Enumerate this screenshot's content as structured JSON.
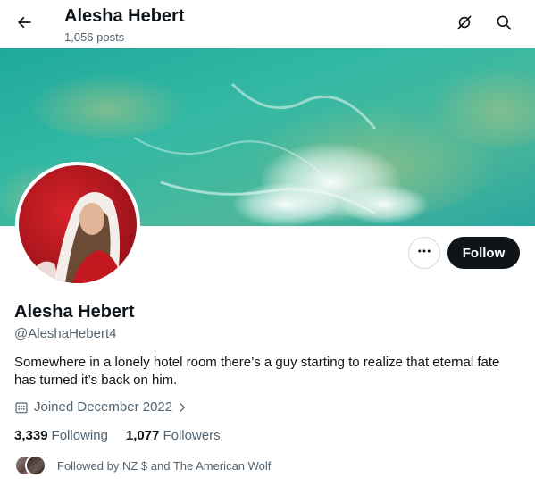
{
  "header": {
    "title": "Alesha Hebert",
    "post_count": "1,056 posts"
  },
  "icons": {
    "back": "arrow-left-icon",
    "grok": "grok-icon",
    "search": "search-icon",
    "more": "more-horizontal-icon",
    "calendar": "calendar-icon",
    "chevron": "chevron-right-icon"
  },
  "actions": {
    "follow_label": "Follow"
  },
  "profile": {
    "name": "Alesha Hebert",
    "handle": "@AleshaHebert4",
    "bio": "Somewhere in a lonely hotel room there’s a guy starting to realize that eternal fate has turned it’s back on him.",
    "joined": "Joined December 2022"
  },
  "stats": {
    "following_count": "3,339",
    "following_label": "Following",
    "followers_count": "1,077",
    "followers_label": "Followers"
  },
  "followed_by": {
    "text": "Followed by NZ $ and The American Wolf"
  },
  "colors": {
    "text_primary": "#0f1419",
    "text_secondary": "#536471",
    "follow_button_bg": "#0f1419",
    "banner_sea": "#2bb3a3"
  }
}
